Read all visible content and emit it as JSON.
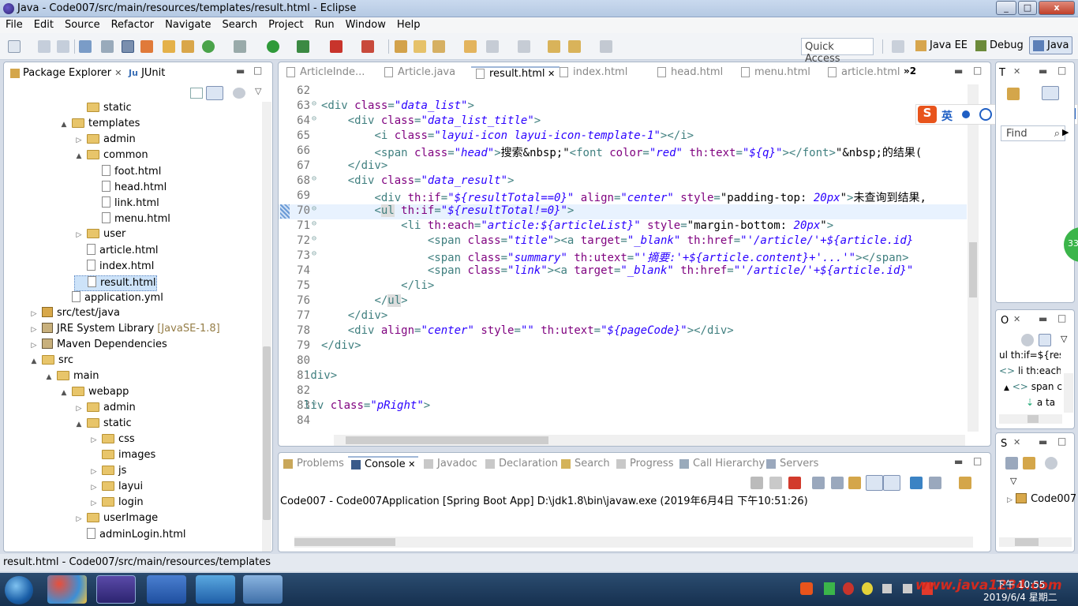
{
  "window": {
    "title": "Java - Code007/src/main/resources/templates/result.html - Eclipse",
    "minimize": "_",
    "maximize": "□",
    "close": "x"
  },
  "menu": [
    "File",
    "Edit",
    "Source",
    "Refactor",
    "Navigate",
    "Search",
    "Project",
    "Run",
    "Window",
    "Help"
  ],
  "toolbar": {
    "quick_access": "Quick Access",
    "perspectives": [
      "Java EE",
      "Debug",
      "Java"
    ]
  },
  "left_tabs": {
    "package_explorer": "Package Explorer",
    "junit": "JUnit"
  },
  "tree": [
    {
      "label": "static",
      "type": "folder",
      "level": 4,
      "tw": ""
    },
    {
      "label": "templates",
      "type": "folder",
      "level": 3,
      "tw": "▲"
    },
    {
      "label": "admin",
      "type": "folder",
      "level": 4,
      "tw": "▷"
    },
    {
      "label": "common",
      "type": "folder",
      "level": 4,
      "tw": "▲"
    },
    {
      "label": "foot.html",
      "type": "file",
      "level": 5,
      "tw": ""
    },
    {
      "label": "head.html",
      "type": "file",
      "level": 5,
      "tw": ""
    },
    {
      "label": "link.html",
      "type": "file",
      "level": 5,
      "tw": ""
    },
    {
      "label": "menu.html",
      "type": "file",
      "level": 5,
      "tw": ""
    },
    {
      "label": "user",
      "type": "folder",
      "level": 4,
      "tw": "▷"
    },
    {
      "label": "article.html",
      "type": "file",
      "level": 4,
      "tw": ""
    },
    {
      "label": "index.html",
      "type": "file",
      "level": 4,
      "tw": ""
    },
    {
      "label": "result.html",
      "type": "file",
      "level": 4,
      "tw": "",
      "selected": true
    },
    {
      "label": "application.yml",
      "type": "file",
      "level": 3,
      "tw": ""
    },
    {
      "label": "src/test/java",
      "type": "pkg",
      "level": 1,
      "tw": "▷"
    },
    {
      "label": "JRE System Library",
      "type": "lib",
      "level": 1,
      "tw": "▷",
      "suffix": "[JavaSE-1.8]"
    },
    {
      "label": "Maven Dependencies",
      "type": "lib",
      "level": 1,
      "tw": "▷"
    },
    {
      "label": "src",
      "type": "folder",
      "level": 1,
      "tw": "▲"
    },
    {
      "label": "main",
      "type": "folder",
      "level": 2,
      "tw": "▲"
    },
    {
      "label": "webapp",
      "type": "folder",
      "level": 3,
      "tw": "▲"
    },
    {
      "label": "admin",
      "type": "folder",
      "level": 4,
      "tw": "▷"
    },
    {
      "label": "static",
      "type": "folder",
      "level": 4,
      "tw": "▲"
    },
    {
      "label": "css",
      "type": "folder",
      "level": 5,
      "tw": "▷"
    },
    {
      "label": "images",
      "type": "folder",
      "level": 5,
      "tw": ""
    },
    {
      "label": "js",
      "type": "folder",
      "level": 5,
      "tw": "▷"
    },
    {
      "label": "layui",
      "type": "folder",
      "level": 5,
      "tw": "▷"
    },
    {
      "label": "login",
      "type": "folder",
      "level": 5,
      "tw": "▷"
    },
    {
      "label": "userImage",
      "type": "folder",
      "level": 4,
      "tw": "▷"
    },
    {
      "label": "adminLogin.html",
      "type": "file",
      "level": 4,
      "tw": ""
    }
  ],
  "editor_tabs": [
    "ArticleInde...",
    "Article.java",
    "result.html",
    "index.html",
    "head.html",
    "menu.html",
    "article.html"
  ],
  "editor_overflow": "»2",
  "code": [
    {
      "n": "62",
      "fold": "",
      "html": ""
    },
    {
      "n": "63",
      "fold": "⊖",
      "html": "<span class='tag'>&lt;div</span> <span class='attr'>class</span>=<span class='val'>\"data_list\"</span><span class='tag'>&gt;</span>"
    },
    {
      "n": "64",
      "fold": "⊖",
      "html": "    <span class='tag'>&lt;div</span> <span class='attr'>class</span>=<span class='val'>\"data_list_title\"</span><span class='tag'>&gt;</span>"
    },
    {
      "n": "65",
      "fold": "",
      "html": "        <span class='tag'>&lt;i</span> <span class='attr'>class</span>=<span class='val'>\"layui-icon layui-icon-template-1\"</span><span class='tag'>&gt;&lt;/i&gt;</span>"
    },
    {
      "n": "66",
      "fold": "",
      "html": "        <span class='tag'>&lt;span</span> <span class='attr'>class</span>=<span class='val'>\"head\"</span><span class='tag'>&gt;</span><span class='txt'>搜索&amp;nbsp;\"</span><span class='tag'>&lt;font</span> <span class='attr'>color</span>=<span class='val'>\"red\"</span> <span class='attr'>th:text</span>=<span class='val'>\"${q}\"</span><span class='tag'>&gt;&lt;/font&gt;</span><span class='txt'>\"&amp;nbsp;的结果(</span>"
    },
    {
      "n": "67",
      "fold": "",
      "html": "    <span class='tag'>&lt;/div&gt;</span>"
    },
    {
      "n": "68",
      "fold": "⊖",
      "html": "    <span class='tag'>&lt;div</span> <span class='attr'>class</span>=<span class='val'>\"data_result\"</span><span class='tag'>&gt;</span>"
    },
    {
      "n": "69",
      "fold": "",
      "html": "        <span class='tag'>&lt;div</span> <span class='attr'>th:if</span>=<span class='val'>\"${resultTotal==0}\"</span> <span class='attr'>align</span>=<span class='val'>\"center\"</span> <span class='attr'>style</span>=<span class='txt'>\"padding-top: </span><span class='val'>20px</span><span class='txt'>\"</span><span class='tag'>&gt;</span><span class='txt'>未查询到结果,</span>"
    },
    {
      "n": "70",
      "fold": "⊖",
      "html": "        <span class='tag'>&lt;</span><span class='tag' style='background:#ddd'>ul</span> <span class='attr'>th:if</span>=<span class='val'>\"${resultTotal!=0}\"</span><span class='tag'>&gt;</span>",
      "current": true
    },
    {
      "n": "71",
      "fold": "⊖",
      "html": "            <span class='tag'>&lt;li</span> <span class='attr'>th:each</span>=<span class='val'>\"article:${articleList}\"</span> <span class='attr'>style</span>=<span class='txt'>\"margin-bottom: </span><span class='val'>20px</span><span class='txt'>\"</span><span class='tag'>&gt;</span>"
    },
    {
      "n": "72",
      "fold": "⊖",
      "html": "                <span class='tag'>&lt;span</span> <span class='attr'>class</span>=<span class='val'>\"title\"</span><span class='tag'>&gt;&lt;a</span> <span class='attr'>target</span>=<span class='val'>\"_blank\"</span> <span class='attr'>th:href</span>=<span class='val'>\"'/article/'+${article.id}</span>"
    },
    {
      "n": "73",
      "fold": "⊖",
      "html": "                <span class='tag'>&lt;span</span> <span class='attr'>class</span>=<span class='val'>\"summary\"</span> <span class='attr'>th:utext</span>=<span class='val'>\"'摘要:'+${article.content}+'...'\"</span><span class='tag'>&gt;&lt;/span&gt;</span>"
    },
    {
      "n": "74",
      "fold": "",
      "html": "                <span class='tag'>&lt;span</span> <span class='attr'>class</span>=<span class='val'>\"link\"</span><span class='tag'>&gt;&lt;a</span> <span class='attr'>target</span>=<span class='val'>\"_blank\"</span> <span class='attr'>th:href</span>=<span class='val'>\"'/article/'+${article.id}\"</span>"
    },
    {
      "n": "75",
      "fold": "",
      "html": "            <span class='tag'>&lt;/li&gt;</span>"
    },
    {
      "n": "76",
      "fold": "",
      "html": "        <span class='tag'>&lt;/</span><span class='tag' style='background:#ddd'>ul</span><span class='tag'>&gt;</span>"
    },
    {
      "n": "77",
      "fold": "",
      "html": "    <span class='tag'>&lt;/div&gt;</span>"
    },
    {
      "n": "78",
      "fold": "",
      "html": "    <span class='tag'>&lt;div</span> <span class='attr'>align</span>=<span class='val'>\"center\"</span> <span class='attr'>style</span>=<span class='val'>\"\"</span> <span class='attr'>th:utext</span>=<span class='val'>\"${pageCode}\"</span><span class='tag'>&gt;&lt;/div&gt;</span>"
    },
    {
      "n": "79",
      "fold": "",
      "html": "<span class='tag'>&lt;/div&gt;</span>"
    },
    {
      "n": "80",
      "fold": "",
      "html": ""
    },
    {
      "n": "81",
      "fold": "",
      "html": "<span class='tag' style='margin-left:-22px'>'div&gt;</span>"
    },
    {
      "n": "82",
      "fold": "",
      "html": ""
    },
    {
      "n": "83",
      "fold": "⊖",
      "html": "<span class='tag' style='margin-left:-22px'>liv</span> <span class='attr'>class</span>=<span class='val'>\"pRight\"</span><span class='tag'>&gt;</span>"
    },
    {
      "n": "84",
      "fold": "",
      "html": ""
    }
  ],
  "bottom_tabs": [
    "Problems",
    "Console",
    "Javadoc",
    "Declaration",
    "Search",
    "Progress",
    "Call Hierarchy",
    "Servers"
  ],
  "console": {
    "header": "Code007 - Code007Application [Spring Boot App] D:\\jdk1.8\\bin\\javaw.exe (2019年6月4日 下午10:51:26)"
  },
  "right": {
    "task_tab": "T",
    "find": "Find",
    "outline_tab": "O",
    "outline_items": [
      "ul th:if=${resu",
      "li th:each=",
      "span c",
      "a ta"
    ],
    "servers_tab": "S",
    "servers_item": "Code007",
    "badge": "33",
    "ime_label": "英"
  },
  "status": {
    "path": "result.html - Code007/src/main/resources/templates"
  },
  "taskbar": {
    "time": "下午 10:55",
    "date": "2019/6/4 星期二",
    "watermark": "www.java1234.com"
  }
}
